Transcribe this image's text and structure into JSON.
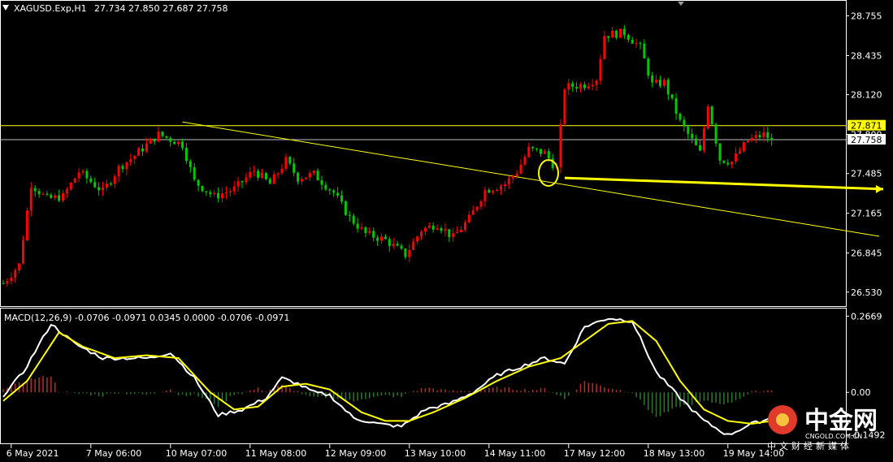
{
  "colors": {
    "background": "#000000",
    "bull": "#ff0000",
    "bear": "#00c800",
    "trendline": "#ffff00",
    "current_line": "#c0c0c0",
    "macd_main": "#ffffff",
    "macd_signal": "#ffff00",
    "hist_pos": "#b03030",
    "hist_neg": "#2a7a2a",
    "text": "#ffffff",
    "frame": "#ffffff"
  },
  "icons": [
    "dropdown-triangle-icon",
    "scroll-marker-icon"
  ],
  "chart_data": [
    {
      "type": "candlestick",
      "title": "XAGUSD.Exp,H1",
      "ohlc_text": "27.734 27.850 27.687 27.758",
      "y_ticks": [
        "28.755",
        "28.435",
        "28.120",
        "27.800",
        "27.485",
        "27.165",
        "26.845",
        "26.530"
      ],
      "tick_values": [
        28.755,
        28.435,
        28.12,
        27.8,
        27.485,
        27.165,
        26.845,
        26.53
      ],
      "ylim": [
        26.45,
        28.85
      ],
      "x_ticks": [
        "6 May 2021",
        "7 May 06:00",
        "10 May 07:00",
        "11 May 08:00",
        "12 May 09:00",
        "13 May 10:00",
        "14 May 11:00",
        "17 May 12:00",
        "18 May 13:00",
        "19 May 14:00"
      ],
      "x_tick_bars": [
        2,
        22,
        42,
        62,
        82,
        102,
        122,
        142,
        162,
        182
      ],
      "current_price": "27.758",
      "current_value": 27.758,
      "level_label": "27.871",
      "level_value": 27.871,
      "anchors": [
        [
          0,
          26.6
        ],
        [
          4,
          26.75
        ],
        [
          7,
          27.4
        ],
        [
          11,
          27.28
        ],
        [
          15,
          27.3
        ],
        [
          19,
          27.5
        ],
        [
          25,
          27.34
        ],
        [
          29,
          27.53
        ],
        [
          33,
          27.63
        ],
        [
          39,
          27.8
        ],
        [
          45,
          27.72
        ],
        [
          48,
          27.42
        ],
        [
          53,
          27.3
        ],
        [
          58,
          27.36
        ],
        [
          63,
          27.51
        ],
        [
          67,
          27.4
        ],
        [
          71,
          27.59
        ],
        [
          74,
          27.45
        ],
        [
          78,
          27.48
        ],
        [
          83,
          27.33
        ],
        [
          87,
          27.13
        ],
        [
          91,
          27.0
        ],
        [
          96,
          26.95
        ],
        [
          101,
          26.83
        ],
        [
          105,
          27.03
        ],
        [
          109,
          27.08
        ],
        [
          113,
          26.97
        ],
        [
          117,
          27.12
        ],
        [
          121,
          27.35
        ],
        [
          126,
          27.4
        ],
        [
          129,
          27.5
        ],
        [
          132,
          27.68
        ],
        [
          136,
          27.65
        ],
        [
          139,
          27.52
        ],
        [
          141,
          28.18
        ],
        [
          146,
          28.2
        ],
        [
          149,
          28.25
        ],
        [
          151,
          28.6
        ],
        [
          156,
          28.62
        ],
        [
          160,
          28.5
        ],
        [
          163,
          28.2
        ],
        [
          166,
          28.22
        ],
        [
          170,
          27.9
        ],
        [
          172,
          27.8
        ],
        [
          175,
          27.65
        ],
        [
          177,
          28.05
        ],
        [
          180,
          27.6
        ],
        [
          183,
          27.58
        ],
        [
          187,
          27.75
        ],
        [
          191,
          27.8
        ],
        [
          193,
          27.758
        ]
      ],
      "trendlines": [
        {
          "from": [
            45,
            27.9
          ],
          "to": [
            220,
            26.98
          ]
        },
        {
          "from": [
            141,
            27.45
          ],
          "to": [
            221,
            27.36
          ]
        }
      ]
    },
    {
      "type": "line",
      "title": "MACD(12,26,9) -0.0706 -0.0971 0.0345 0.0000 -0.0706 -0.0971",
      "y_ticks": [
        "0.2669",
        "0.00",
        "-0.1492"
      ],
      "tick_values": [
        0.2669,
        0.0,
        -0.1492
      ],
      "ylim": [
        -0.17,
        0.285
      ],
      "main_anchors": [
        [
          0,
          -0.01
        ],
        [
          5,
          0.07
        ],
        [
          12,
          0.24
        ],
        [
          18,
          0.17
        ],
        [
          25,
          0.12
        ],
        [
          31,
          0.12
        ],
        [
          37,
          0.12
        ],
        [
          42,
          0.14
        ],
        [
          48,
          0.05
        ],
        [
          54,
          -0.08
        ],
        [
          60,
          -0.06
        ],
        [
          66,
          -0.02
        ],
        [
          70,
          0.05
        ],
        [
          74,
          0.03
        ],
        [
          78,
          0.0
        ],
        [
          82,
          -0.01
        ],
        [
          88,
          -0.09
        ],
        [
          94,
          -0.11
        ],
        [
          100,
          -0.12
        ],
        [
          106,
          -0.06
        ],
        [
          112,
          -0.04
        ],
        [
          118,
          0.0
        ],
        [
          124,
          0.06
        ],
        [
          130,
          0.09
        ],
        [
          136,
          0.12
        ],
        [
          141,
          0.1
        ],
        [
          146,
          0.23
        ],
        [
          152,
          0.26
        ],
        [
          158,
          0.25
        ],
        [
          164,
          0.07
        ],
        [
          170,
          -0.02
        ],
        [
          176,
          -0.1
        ],
        [
          182,
          -0.15
        ],
        [
          188,
          -0.11
        ],
        [
          193,
          -0.09
        ]
      ],
      "signal_anchors": [
        [
          0,
          -0.03
        ],
        [
          6,
          0.04
        ],
        [
          14,
          0.21
        ],
        [
          20,
          0.16
        ],
        [
          28,
          0.12
        ],
        [
          36,
          0.13
        ],
        [
          44,
          0.12
        ],
        [
          52,
          0.0
        ],
        [
          58,
          -0.06
        ],
        [
          64,
          -0.05
        ],
        [
          70,
          0.02
        ],
        [
          76,
          0.03
        ],
        [
          82,
          0.01
        ],
        [
          90,
          -0.07
        ],
        [
          96,
          -0.1
        ],
        [
          102,
          -0.1
        ],
        [
          108,
          -0.07
        ],
        [
          116,
          -0.02
        ],
        [
          124,
          0.04
        ],
        [
          132,
          0.09
        ],
        [
          140,
          0.12
        ],
        [
          146,
          0.18
        ],
        [
          152,
          0.24
        ],
        [
          158,
          0.25
        ],
        [
          164,
          0.18
        ],
        [
          170,
          0.04
        ],
        [
          176,
          -0.06
        ],
        [
          182,
          -0.1
        ],
        [
          188,
          -0.11
        ],
        [
          193,
          -0.1
        ]
      ]
    }
  ],
  "watermark": {
    "name": "中金网",
    "domain": "CNGOLD.COM.CN",
    "slogan": "中文财经新媒体"
  }
}
